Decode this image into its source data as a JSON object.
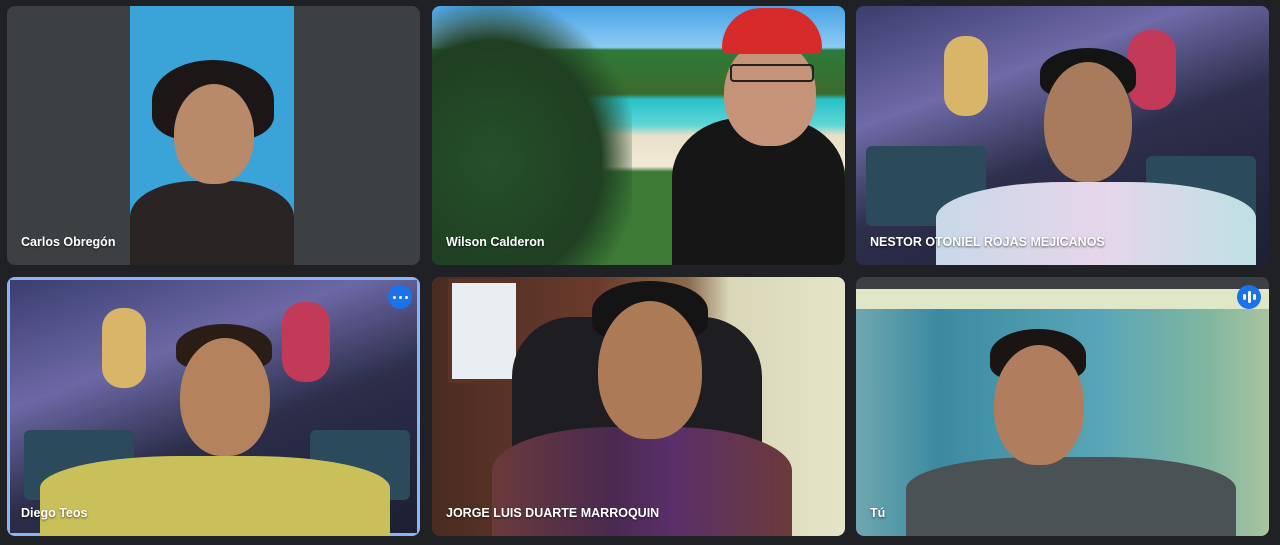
{
  "participants": [
    {
      "name": "Carlos Obregón"
    },
    {
      "name": "Wilson Calderon"
    },
    {
      "name": "NESTOR OTONIEL ROJAS MEJICANOS"
    },
    {
      "name": "Diego Teos"
    },
    {
      "name": "JORGE LUIS DUARTE MARROQUIN"
    },
    {
      "name": "Tú"
    }
  ],
  "icons": {
    "more_options": "more-vert-icon",
    "speaking": "audio-level-icon"
  },
  "colors": {
    "background": "#202124",
    "tile": "#3c4043",
    "active_border": "#8ab4f8",
    "accent": "#1a73e8"
  }
}
